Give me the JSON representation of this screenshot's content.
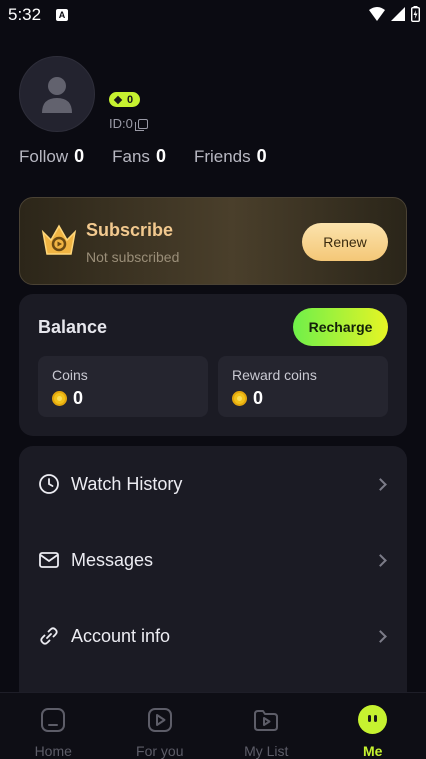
{
  "status_bar": {
    "time": "5:32",
    "notif_glyph": "A"
  },
  "profile": {
    "badge_value": "0",
    "id_text": "ID:0",
    "stats": [
      {
        "label": "Follow",
        "value": "0"
      },
      {
        "label": "Fans",
        "value": "0"
      },
      {
        "label": "Friends",
        "value": "0"
      }
    ]
  },
  "subscribe": {
    "title": "Subscribe",
    "status": "Not subscribed",
    "button": "Renew"
  },
  "balance": {
    "title": "Balance",
    "button": "Recharge",
    "coins": {
      "label": "Coins",
      "value": "0"
    },
    "reward": {
      "label": "Reward coins",
      "value": "0"
    }
  },
  "menu": [
    {
      "label": "Watch History",
      "icon": "clock-icon"
    },
    {
      "label": "Messages",
      "icon": "mail-icon"
    },
    {
      "label": "Account info",
      "icon": "link-icon"
    }
  ],
  "nav": [
    {
      "label": "Home",
      "icon": "home-icon"
    },
    {
      "label": "For you",
      "icon": "play-square-icon"
    },
    {
      "label": "My List",
      "icon": "folder-play-icon"
    },
    {
      "label": "Me",
      "icon": "me-face-icon",
      "active": true
    }
  ],
  "colors": {
    "accent": "#c6f230",
    "background": "#0b0b12",
    "card": "#1b1b24",
    "gold": "#f2c98f"
  }
}
